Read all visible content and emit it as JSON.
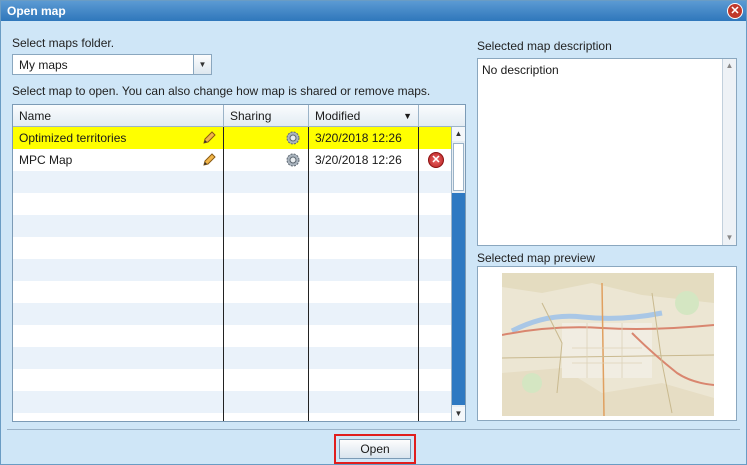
{
  "window": {
    "title": "Open map",
    "close_symbol": "✕"
  },
  "folder": {
    "label": "Select maps folder.",
    "selected": "My maps",
    "dropdown_arrow": "▼"
  },
  "instructions": "Select map to open. You can also change how map is shared or remove maps.",
  "table": {
    "columns": {
      "name": "Name",
      "sharing": "Sharing",
      "modified": "Modified",
      "sort_indicator": "▼"
    },
    "rows": [
      {
        "name": "Optimized territories",
        "modified": "3/20/2018 12:26",
        "selected": true,
        "removable": false
      },
      {
        "name": "MPC Map",
        "modified": "3/20/2018 12:26",
        "selected": false,
        "removable": true
      }
    ],
    "scroll_up": "▲",
    "scroll_down": "▼",
    "delete_symbol": "✕"
  },
  "description": {
    "label": "Selected map description",
    "text": "No description",
    "scroll_up": "▲",
    "scroll_down": "▼"
  },
  "preview": {
    "label": "Selected map preview"
  },
  "actions": {
    "open_label": "Open"
  },
  "colors": {
    "selected_row": "#ffff00",
    "title_bar": "#2f77bb",
    "highlight_border": "#e01e1e",
    "delete_red": "#c0392b"
  }
}
